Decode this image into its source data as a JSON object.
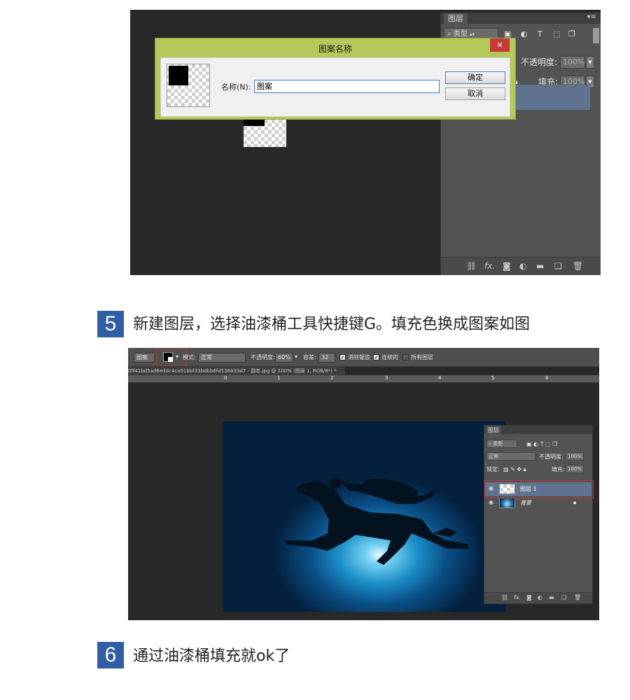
{
  "shot1": {
    "layers_panel": {
      "tab": "图层",
      "filter_kind": "类型",
      "opacity_label": "不透明度:",
      "opacity_value": "100%",
      "fill_label": "填充:",
      "fill_value": "100%"
    },
    "dialog": {
      "title": "图案名称",
      "name_label": "名称(N):",
      "name_value": "图案",
      "ok_label": "确定",
      "cancel_label": "取消",
      "close_glyph": "✕"
    }
  },
  "step5": {
    "number": "5",
    "text": "新建图层，选择油漆桶工具快捷键G。填充色换成图案如图"
  },
  "shot2": {
    "options_bar": {
      "source": "图案",
      "mode_label": "模式:",
      "mode_value": "正常",
      "opacity_label": "不透明度:",
      "opacity_value": "60%",
      "tolerance_label": "容差:",
      "tolerance_value": "32",
      "antialias_label": "消除锯齿",
      "contiguous_label": "连续的",
      "all_layers_label": "所有图层"
    },
    "document_tab": "0ff41bd5ad6eddc4ca01bbf33bdbb6fd536633d7 - 副本.jpg @ 100% (图层 1, RGB/8*) *",
    "ruler_ticks": [
      "0",
      "1",
      "2",
      "3",
      "4",
      "5",
      "6"
    ],
    "layers_panel": {
      "tab": "图层",
      "filter_kind": "类型",
      "blend_mode": "正常",
      "opacity_label": "不透明度:",
      "opacity_value": "100%",
      "lock_label": "锁定:",
      "fill_label": "填充:",
      "fill_value": "100%",
      "layers": [
        {
          "name": "图层 1"
        },
        {
          "name": "背景"
        }
      ]
    }
  },
  "step6": {
    "number": "6",
    "text": "通过油漆桶填充就ok了"
  },
  "colors": {
    "step_badge": "#2f5da6",
    "dialog_frame": "#b5c85a",
    "close_button": "#c8393a",
    "selected_layer": "#5f7391",
    "highlight_box": "#d03030"
  }
}
